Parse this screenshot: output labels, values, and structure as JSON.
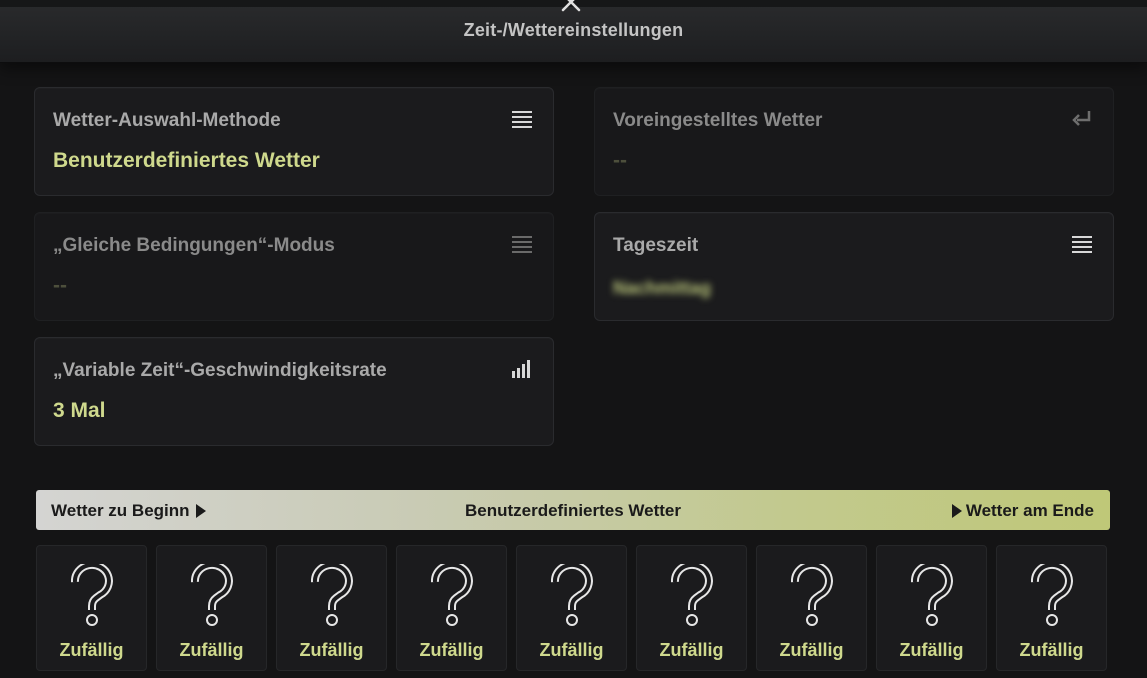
{
  "header": {
    "title": "Zeit-/Wettereinstellungen"
  },
  "settings": {
    "weather_method": {
      "label": "Wetter-Auswahl-Methode",
      "value": "Benutzerdefiniertes Wetter",
      "icon": "list-icon"
    },
    "preset_weather": {
      "label": "Voreingestelltes Wetter",
      "value": "--",
      "icon": "return-icon"
    },
    "same_conditions": {
      "label": "„Gleiche Bedingungen“-Modus",
      "value": "--",
      "icon": "list-icon"
    },
    "time_of_day": {
      "label": "Tageszeit",
      "value": "Nachmittag",
      "icon": "list-icon"
    },
    "variable_time_rate": {
      "label": "„Variable Zeit“-Geschwindigkeitsrate",
      "value": "3 Mal",
      "icon": "signal-bars-icon"
    }
  },
  "banner": {
    "left": "Wetter zu Beginn",
    "center": "Benutzerdefiniertes Wetter",
    "right": "Wetter am Ende"
  },
  "slots": [
    {
      "label": "Zufällig",
      "icon": "question-mark-icon"
    },
    {
      "label": "Zufällig",
      "icon": "question-mark-icon"
    },
    {
      "label": "Zufällig",
      "icon": "question-mark-icon"
    },
    {
      "label": "Zufällig",
      "icon": "question-mark-icon"
    },
    {
      "label": "Zufällig",
      "icon": "question-mark-icon"
    },
    {
      "label": "Zufällig",
      "icon": "question-mark-icon"
    },
    {
      "label": "Zufällig",
      "icon": "question-mark-icon"
    },
    {
      "label": "Zufällig",
      "icon": "question-mark-icon"
    },
    {
      "label": "Zufällig",
      "icon": "question-mark-icon"
    }
  ],
  "colors": {
    "accent": "#cfd98d",
    "background": "#141415",
    "card": "#1b1b1d"
  }
}
